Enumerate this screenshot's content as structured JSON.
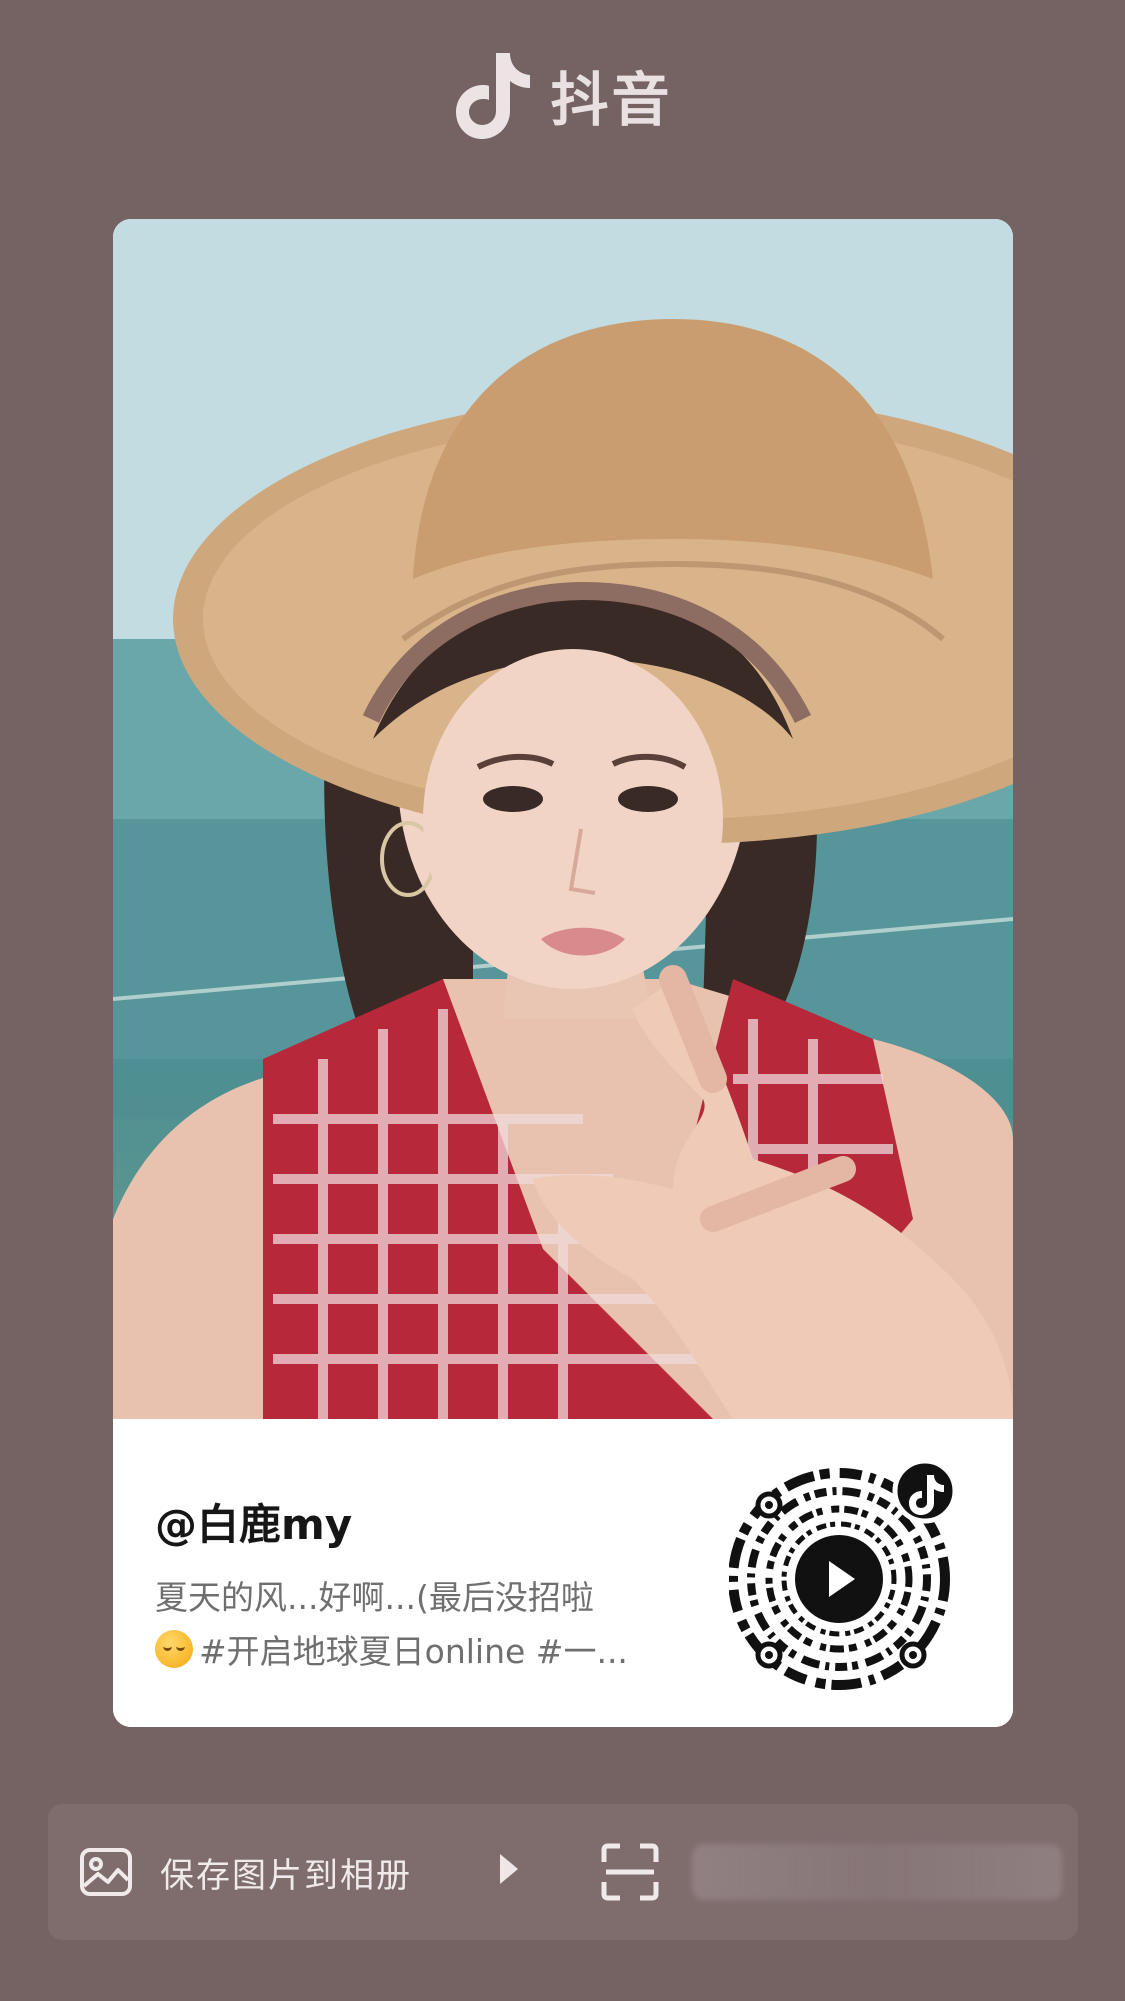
{
  "app": {
    "name": "抖音"
  },
  "card": {
    "username": "@白鹿my",
    "description_line1": "夏天的风...好啊...(最后没招啦",
    "description_line2": "#开启地球夏日online #一...",
    "description_emoji": "relieved-face-emoji"
  },
  "actions": {
    "save_label": "保存图片到相册",
    "save_icon": "image-icon",
    "play_icon": "play-triangle-icon",
    "scan_icon": "scan-icon"
  },
  "colors": {
    "background": "#756364",
    "bar": "#7f6d6e",
    "card": "#ffffff"
  }
}
